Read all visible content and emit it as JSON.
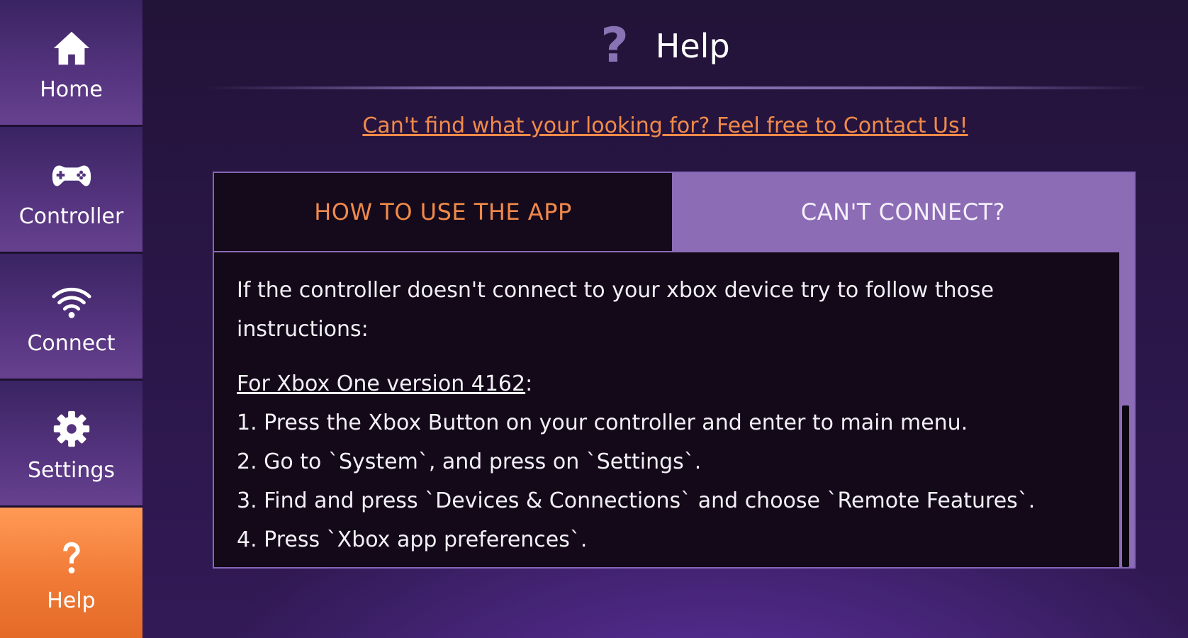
{
  "sidebar": {
    "items": [
      {
        "label": "Home",
        "icon": "home-icon",
        "active": false
      },
      {
        "label": "Controller",
        "icon": "gamepad-icon",
        "active": false
      },
      {
        "label": "Connect",
        "icon": "wifi-icon",
        "active": false
      },
      {
        "label": "Settings",
        "icon": "gear-icon",
        "active": false
      },
      {
        "label": "Help",
        "icon": "question-icon",
        "active": true
      }
    ]
  },
  "header": {
    "title": "Help",
    "icon": "question-icon"
  },
  "contact_link": "Can't find what your looking for? Feel free to Contact Us!",
  "tabs": [
    {
      "label": "HOW TO USE THE APP",
      "selected": false
    },
    {
      "label": "CAN'T CONNECT?",
      "selected": true
    }
  ],
  "content": {
    "intro": "If the controller doesn't connect to your xbox device try to follow those instructions:",
    "version_heading": "For Xbox One version 4162",
    "version_suffix": ":",
    "steps": [
      "1. Press the Xbox Button on your controller and enter to main menu.",
      "2. Go to `System`, and press on `Settings`.",
      "3. Find and press `Devices & Connections` and choose `Remote Features`.",
      "4. Press `Xbox app preferences`."
    ]
  },
  "colors": {
    "accent_orange": "#f0894a",
    "sidebar_purple": "#55347f",
    "tab_selected_purple": "#8c6cb5",
    "content_bg": "#130918"
  }
}
